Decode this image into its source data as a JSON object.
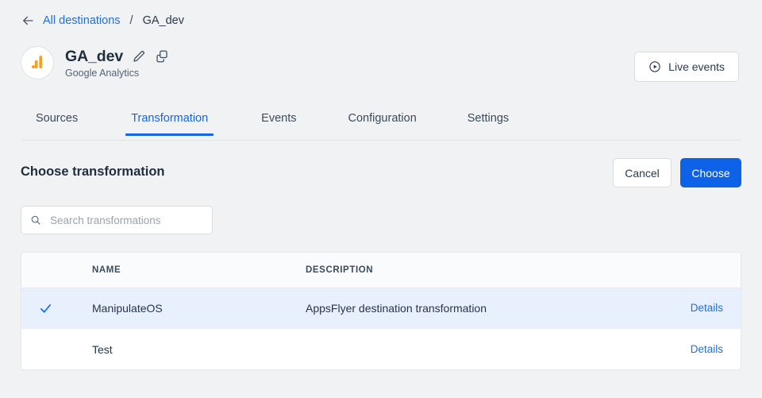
{
  "breadcrumb": {
    "back_icon": "arrow-left-icon",
    "link": "All destinations",
    "separator": "/",
    "current": "GA_dev"
  },
  "destination": {
    "avatar_icon": "google-analytics-logo",
    "title": "GA_dev",
    "subtitle": "Google Analytics",
    "edit_icon": "pencil-icon",
    "copy_icon": "copy-icon"
  },
  "header_actions": {
    "live_events_label": "Live events",
    "live_events_icon": "play-circle-icon"
  },
  "tabs": [
    {
      "label": "Sources",
      "active": false
    },
    {
      "label": "Transformation",
      "active": true
    },
    {
      "label": "Events",
      "active": false
    },
    {
      "label": "Configuration",
      "active": false
    },
    {
      "label": "Settings",
      "active": false
    }
  ],
  "section": {
    "title": "Choose transformation",
    "cancel_label": "Cancel",
    "choose_label": "Choose"
  },
  "search": {
    "placeholder": "Search transformations",
    "value": "",
    "icon": "search-icon"
  },
  "table": {
    "columns": [
      "NAME",
      "DESCRIPTION"
    ],
    "rows": [
      {
        "selected": true,
        "check_icon": "check-icon",
        "name": "ManipulateOS",
        "description": "AppsFlyer destination transformation",
        "details_label": "Details"
      },
      {
        "selected": false,
        "check_icon": "",
        "name": "Test",
        "description": "",
        "details_label": "Details"
      }
    ]
  },
  "colors": {
    "accent_blue": "#1466e0",
    "primary_button": "#0e62e8",
    "link_blue": "#1f6fe0",
    "selected_row": "#e8f0fd",
    "page_background": "#f1f2f3",
    "logo_orange": "#f4a023"
  }
}
